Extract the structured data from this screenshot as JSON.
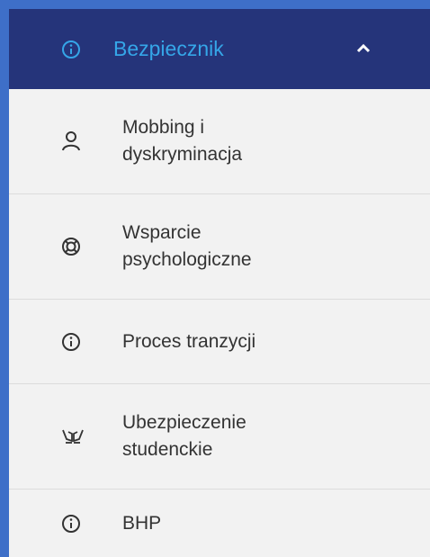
{
  "header": {
    "title": "Bezpiecznik",
    "icon": "info-icon",
    "toggle_icon": "chevron-up-icon",
    "background": "#25347a",
    "accent": "#35a6e8"
  },
  "items": [
    {
      "label": "Mobbing i\ndyskryminacja",
      "icon": "person-icon"
    },
    {
      "label": "Wsparcie\npsychologiczne",
      "icon": "lifebuoy-icon"
    },
    {
      "label": "Proces tranzycji",
      "icon": "info-icon"
    },
    {
      "label": "Ubezpieczenie\nstudenckie",
      "icon": "helping-hands-icon"
    },
    {
      "label": "BHP",
      "icon": "info-icon"
    }
  ]
}
